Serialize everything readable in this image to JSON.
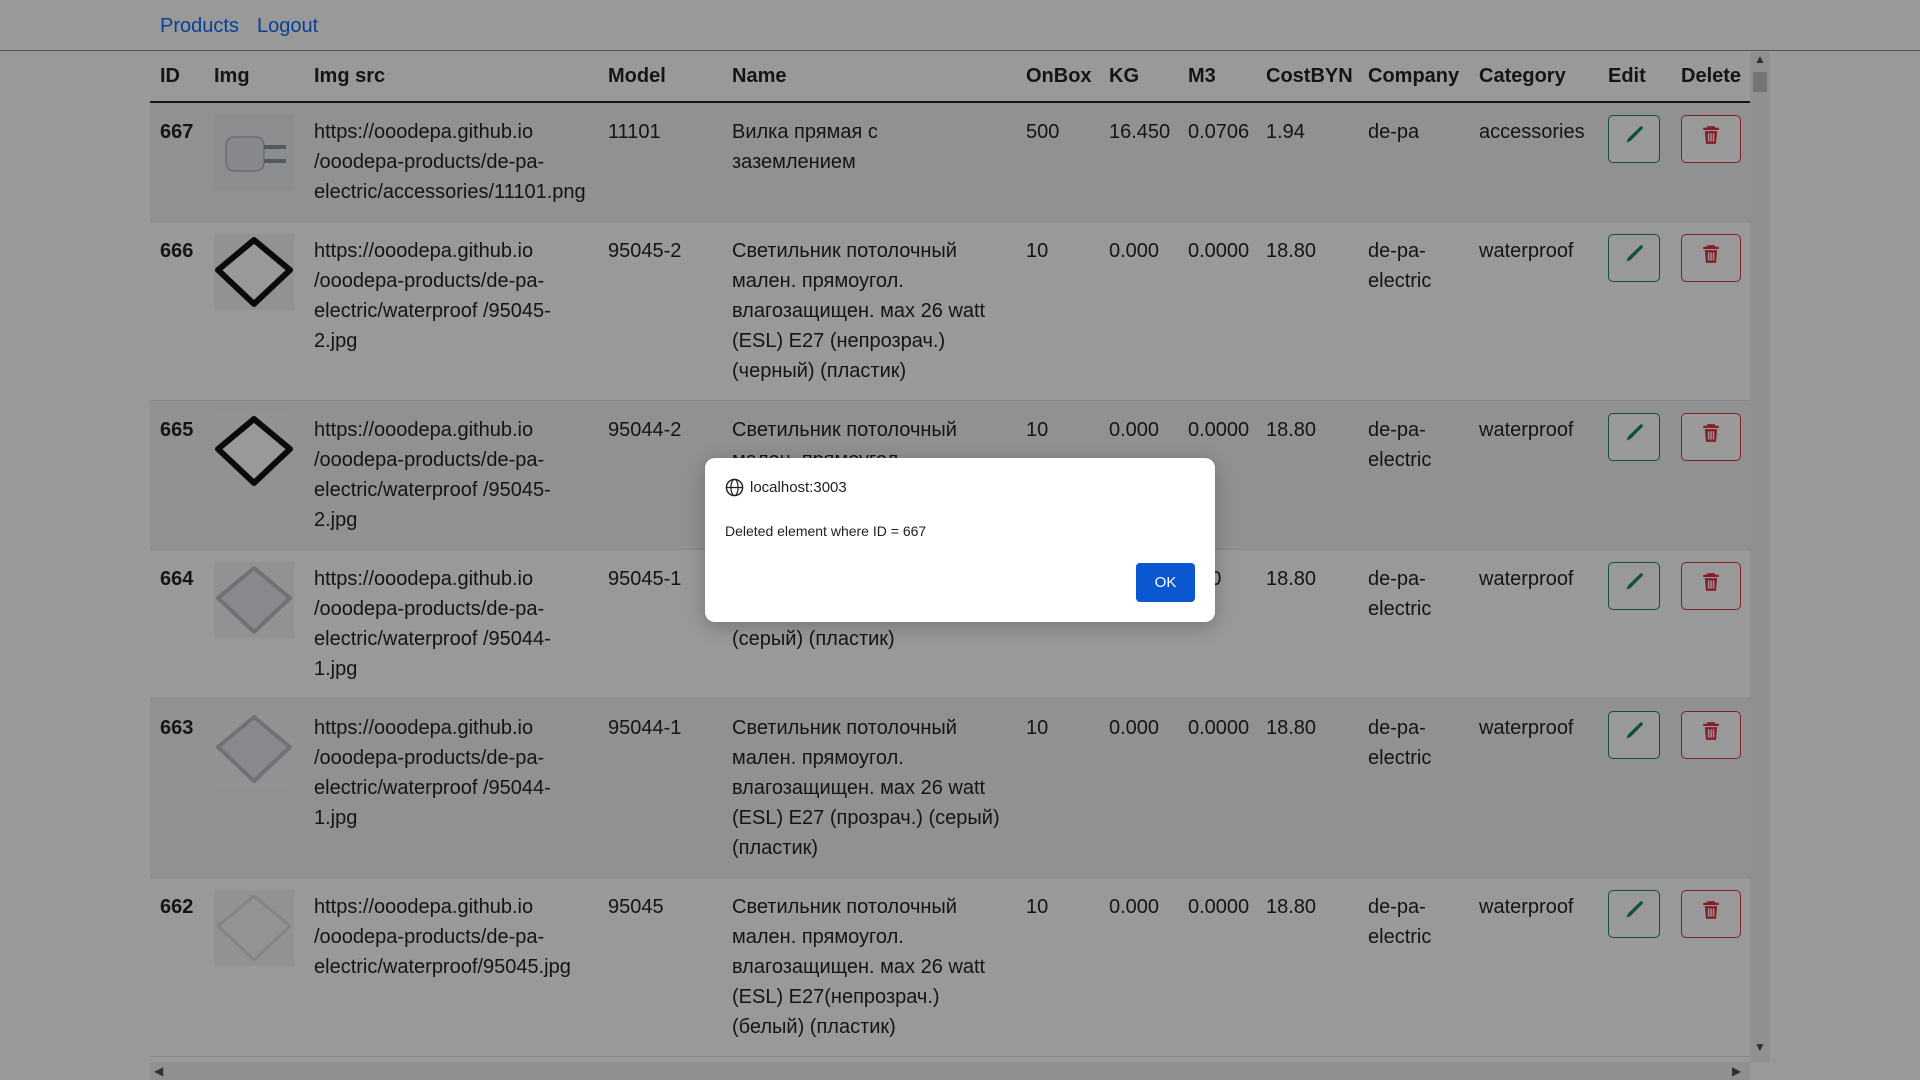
{
  "nav": {
    "products": "Products",
    "logout": "Logout"
  },
  "table": {
    "headers": [
      "ID",
      "Img",
      "Img src",
      "Model",
      "Name",
      "OnBox",
      "KG",
      "M3",
      "CostBYN",
      "Company",
      "Category",
      "Edit",
      "Delete"
    ],
    "rows": [
      {
        "id": "667",
        "img_src": "https://ooodepa.github.io /ooodepa-products/de-pa-electric/accessories/11101.png",
        "model": "11101",
        "name": "Вилка прямая с заземлением",
        "onbox": "500",
        "kg": "16.450",
        "m3": "0.0706",
        "cost": "1.94",
        "company": "de-pa",
        "category": "accessories",
        "image": "plug-icon"
      },
      {
        "id": "666",
        "img_src": "https://ooodepa.github.io /ooodepa-products/de-pa-electric/waterproof /95045-2.jpg",
        "model": "95045-2",
        "name": "Светильник потолочный мален. прямоугол. влагозащищен. мах 26 watt (ESL) E27 (непрозрач.) (черный) (пластик)",
        "onbox": "10",
        "kg": "0.000",
        "m3": "0.0000",
        "cost": "18.80",
        "company": "de-pa- electric",
        "category": "waterproof",
        "image": "black-lamp-icon"
      },
      {
        "id": "665",
        "img_src": "https://ooodepa.github.io /ooodepa-products/de-pa-electric/waterproof /95045-2.jpg",
        "model": "95044-2",
        "name": "Светильник потолочный мален. прямоугол.",
        "onbox": "10",
        "kg": "0.000",
        "m3": "0.0000",
        "cost": "18.80",
        "company": "de-pa- electric",
        "category": "waterproof",
        "image": "black-lamp-icon"
      },
      {
        "id": "664",
        "img_src": "https://ooodepa.github.io /ooodepa-products/de-pa-electric/waterproof /95044-1.jpg",
        "model": "95045-1",
        "name": "влагозащищен. мах 26 watt (ESL) E27 (непрозрач.) (серый) (пластик)",
        "onbox": "10",
        "kg": "",
        "m3": "000",
        "cost": "18.80",
        "company": "de-pa- electric",
        "category": "waterproof",
        "image": "grey-lamp-icon"
      },
      {
        "id": "663",
        "img_src": "https://ooodepa.github.io /ooodepa-products/de-pa-electric/waterproof /95044-1.jpg",
        "model": "95044-1",
        "name": "Светильник потолочный мален. прямоугол. влагозащищен. мах 26 watt (ESL) E27 (прозрач.) (серый) (пластик)",
        "onbox": "10",
        "kg": "0.000",
        "m3": "0.0000",
        "cost": "18.80",
        "company": "de-pa- electric",
        "category": "waterproof",
        "image": "grey-lamp-icon"
      },
      {
        "id": "662",
        "img_src": "https://ooodepa.github.io /ooodepa-products/de-pa-electric/waterproof/95045.jpg",
        "model": "95045",
        "name": "Светильник потолочный мален. прямоугол. влагозащищен. мах 26 watt (ESL) E27(непрозрач.) (белый) (пластик)",
        "onbox": "10",
        "kg": "0.000",
        "m3": "0.0000",
        "cost": "18.80",
        "company": "de-pa- electric",
        "category": "waterproof",
        "image": "white-lamp-icon"
      }
    ]
  },
  "dialog": {
    "origin": "localhost:3003",
    "message": "Deleted element where ID = 667",
    "ok_label": "OK"
  },
  "colors": {
    "link": "#0d6efd",
    "edit": "#198754",
    "delete": "#dc3545",
    "ok_button": "#0b57d0"
  }
}
